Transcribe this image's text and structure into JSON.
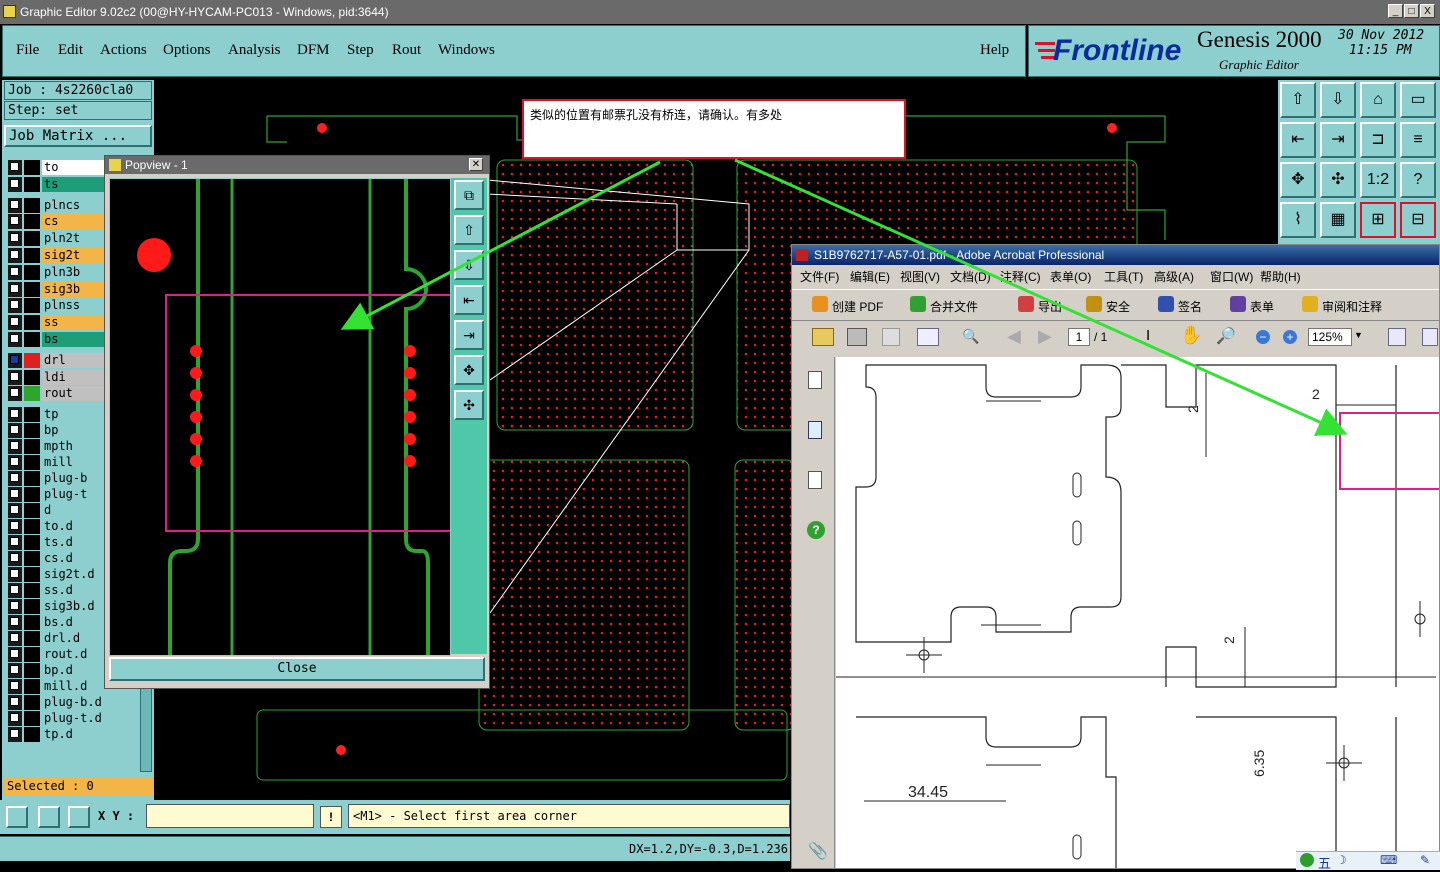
{
  "window": {
    "title": "Graphic Editor 9.02c2 (00@HY-HYCAM-PC013 - Windows, pid:3644)",
    "controls": [
      "_",
      "□",
      "X"
    ]
  },
  "menu": {
    "items": [
      "File",
      "Edit",
      "Actions",
      "Options",
      "Analysis",
      "DFM",
      "Step",
      "Rout",
      "Windows"
    ],
    "help": "Help"
  },
  "brand": {
    "logo": "Frontline",
    "product": "Genesis 2000",
    "subtitle": "Graphic Editor",
    "date": "30 Nov 2012",
    "time": "11:15 PM"
  },
  "job": {
    "job_line": "Job : 4s2260cla0",
    "step_line": "Step: set",
    "matrix_button": "Job Matrix ..."
  },
  "layers": [
    {
      "name": "to",
      "color": "#ffffff"
    },
    {
      "name": "ts",
      "color": "#1e9e78"
    },
    {
      "name": "plncs",
      "color": "#8dcfcf"
    },
    {
      "name": "cs",
      "color": "#f3b548"
    },
    {
      "name": "pln2t",
      "color": "#8dcfcf"
    },
    {
      "name": "sig2t",
      "color": "#f3b548"
    },
    {
      "name": "pln3b",
      "color": "#8dcfcf"
    },
    {
      "name": "sig3b",
      "color": "#f3b548"
    },
    {
      "name": "plnss",
      "color": "#8dcfcf"
    },
    {
      "name": "ss",
      "color": "#f3b548"
    },
    {
      "name": "bs",
      "color": "#1e9e78"
    },
    {
      "name": "drl",
      "color": "#c0c0c0"
    },
    {
      "name": "ldi",
      "color": "#c0c0c0"
    },
    {
      "name": "rout",
      "color": "#c0c0c0"
    },
    {
      "name": "tp",
      "color": "#8dcfcf"
    },
    {
      "name": "bp",
      "color": "#8dcfcf"
    },
    {
      "name": "mpth",
      "color": "#8dcfcf"
    },
    {
      "name": "mill",
      "color": "#8dcfcf"
    },
    {
      "name": "plug-b",
      "color": "#8dcfcf"
    },
    {
      "name": "plug-t",
      "color": "#8dcfcf"
    },
    {
      "name": "d",
      "color": "#8dcfcf"
    },
    {
      "name": "to.d",
      "color": "#8dcfcf"
    },
    {
      "name": "ts.d",
      "color": "#8dcfcf"
    },
    {
      "name": "cs.d",
      "color": "#8dcfcf"
    },
    {
      "name": "sig2t.d",
      "color": "#8dcfcf"
    },
    {
      "name": "ss.d",
      "color": "#8dcfcf"
    },
    {
      "name": "sig3b.d",
      "color": "#8dcfcf"
    },
    {
      "name": "bs.d",
      "color": "#8dcfcf"
    },
    {
      "name": "drl.d",
      "color": "#8dcfcf"
    },
    {
      "name": "rout.d",
      "color": "#8dcfcf"
    },
    {
      "name": "bp.d",
      "color": "#8dcfcf"
    },
    {
      "name": "mill.d",
      "color": "#8dcfcf"
    },
    {
      "name": "plug-b.d",
      "color": "#8dcfcf"
    },
    {
      "name": "plug-t.d",
      "color": "#8dcfcf"
    },
    {
      "name": "tp.d",
      "color": "#8dcfcf"
    }
  ],
  "selected": "Selected : 0",
  "popview": {
    "title": "Popview - 1",
    "close_label": "Close"
  },
  "note": {
    "text": "类似的位置有邮票孔没有桥连，请确认。有多处"
  },
  "acrobat": {
    "title": "S1B9762717-A57-01.pdf - Adobe Acrobat Professional",
    "menu": [
      "文件(F)",
      "编辑(E)",
      "视图(V)",
      "文档(D)",
      "注释(C)",
      "表单(O)",
      "工具(T)",
      "高级(A)",
      "窗口(W)",
      "帮助(H)"
    ],
    "toolbar1": [
      "创建 PDF",
      "合并文件",
      "导出",
      "安全",
      "签名",
      "表单",
      "审阅和注释"
    ],
    "page_current": "1",
    "page_total": "/ 1",
    "zoom": "125%",
    "dims": {
      "d1": "2",
      "d2": "2",
      "d3": "2",
      "d4": "6.35",
      "d5": "34.45"
    }
  },
  "status": {
    "xy_label": "X Y :",
    "prompt": "<M1> - Select first area corner",
    "coords": "DX=1.2,DY=-0.3,D=1.236"
  },
  "tray": {
    "ime": "五"
  },
  "colors": {
    "panel": "#8dcfcf",
    "pcb_dot": "#ff2020",
    "rout_line": "#2ea52e",
    "arrow": "#33e233",
    "highlight": "#e0208a"
  }
}
